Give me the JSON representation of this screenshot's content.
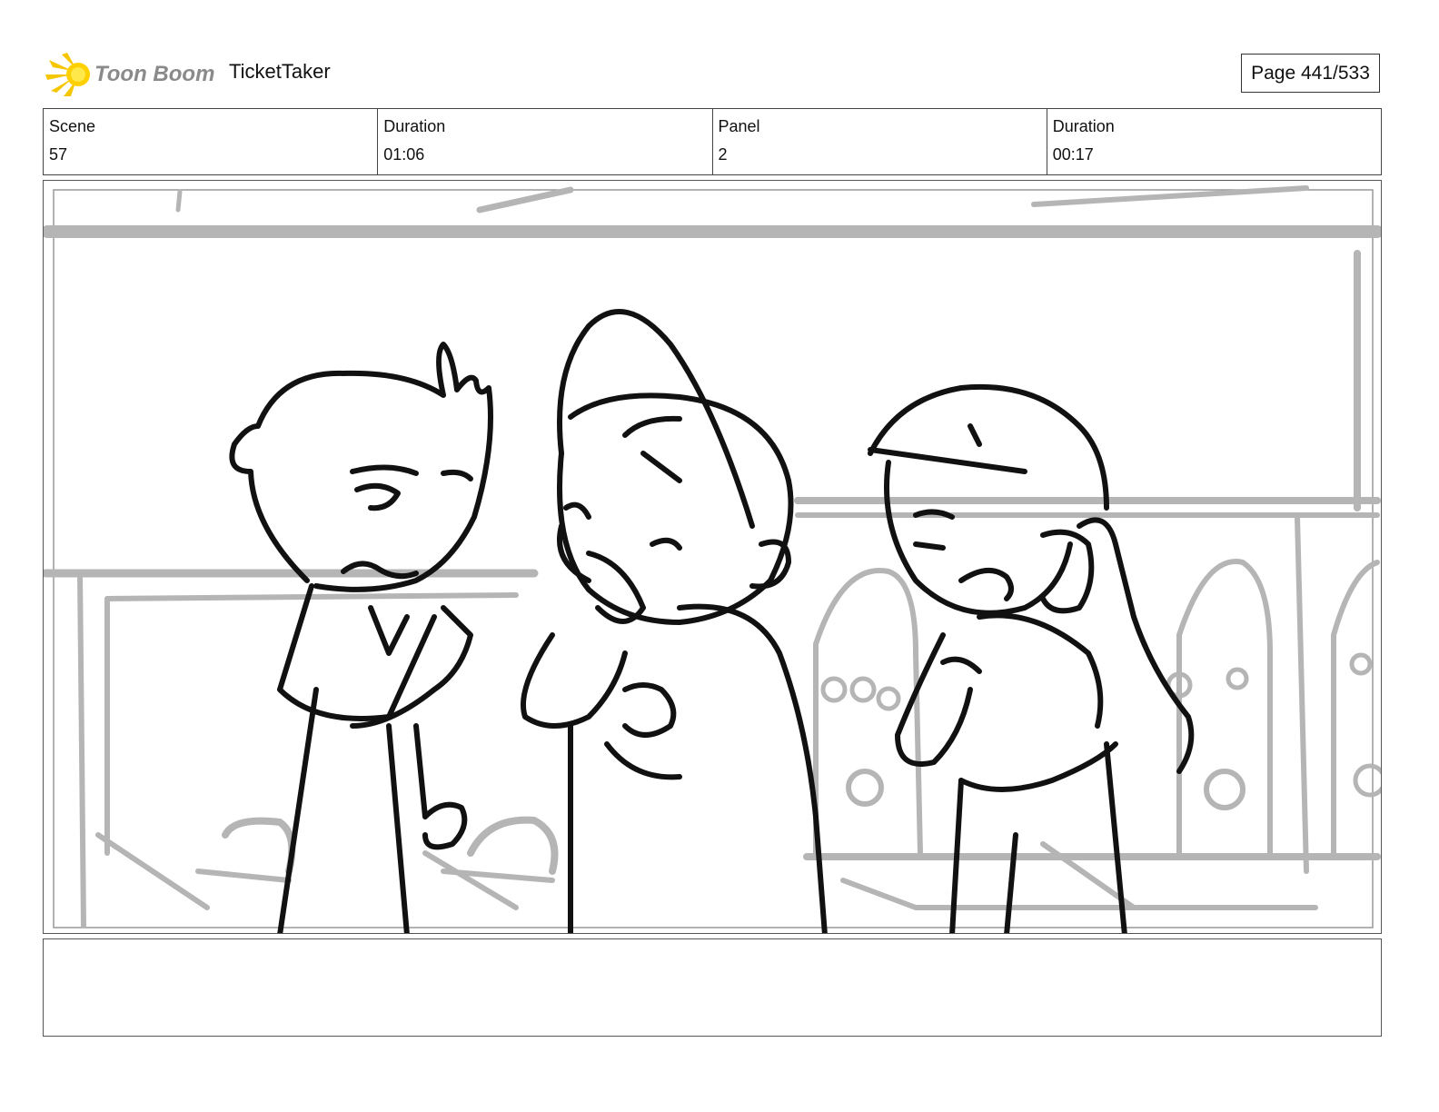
{
  "header": {
    "logo_text": "Toon Boom",
    "project_title": "TicketTaker",
    "page_label": "Page 441/533"
  },
  "info": {
    "scene_label": "Scene",
    "scene_value": "57",
    "scene_duration_label": "Duration",
    "scene_duration_value": "01:06",
    "panel_label": "Panel",
    "panel_value": "2",
    "panel_duration_label": "Duration",
    "panel_duration_value": "00:17"
  },
  "notes": {
    "text": ""
  }
}
